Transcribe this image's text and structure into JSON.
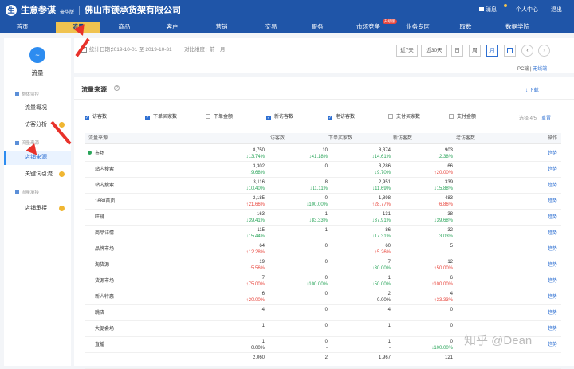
{
  "header": {
    "logo_char": "生",
    "brand": "生意参谋",
    "edition": "豪华版",
    "store": "佛山市镁承货架有限公司",
    "messages": "消息",
    "personal_center": "个人中心",
    "logout": "退出"
  },
  "nav": [
    {
      "label": "首页"
    },
    {
      "label": "流量",
      "active": true
    },
    {
      "label": "商品"
    },
    {
      "label": "客户"
    },
    {
      "label": "营销"
    },
    {
      "label": "交易"
    },
    {
      "label": "服务"
    },
    {
      "label": "市场竞争"
    },
    {
      "label": "业务专区"
    },
    {
      "label": "取数"
    },
    {
      "label": "数据学院"
    }
  ],
  "nav_badge": "升级版",
  "sidebar": {
    "icon_char": "~",
    "title": "流量",
    "groups": [
      {
        "label": "整体监控"
      },
      {
        "label": "流量来源"
      },
      {
        "label": "流量承接"
      }
    ],
    "items": [
      {
        "label": "流量概况"
      },
      {
        "label": "访客分析"
      },
      {
        "label": "店铺来源",
        "active": true
      },
      {
        "label": "关键词引流"
      },
      {
        "label": "店铺承接"
      }
    ]
  },
  "filter": {
    "date_label": "统计日期：",
    "date_range": "2019-10-01 至 2019-10-31",
    "compare_label": "对比维度：",
    "compare_value": "前一月",
    "btn_7": "近7天",
    "btn_30": "近30天",
    "btn_day": "日",
    "btn_week": "周",
    "btn_month": "月",
    "pc_label": "PC端",
    "wireless": "无线端"
  },
  "panel": {
    "title": "流量来源",
    "help": "?",
    "download": "下载",
    "selected": "选择 4/5",
    "reset": "重置",
    "checkboxes": [
      {
        "label": "访客数",
        "checked": true
      },
      {
        "label": "下单买家数",
        "checked": true
      },
      {
        "label": "下单金额",
        "checked": false
      },
      {
        "label": "新访客数",
        "checked": true
      },
      {
        "label": "老访客数",
        "checked": true
      },
      {
        "label": "支付买家数",
        "checked": false
      },
      {
        "label": "支付金额",
        "checked": false
      }
    ]
  },
  "table": {
    "headers": [
      "流量来源",
      "访客数",
      "下单买家数",
      "新访客数",
      "老访客数",
      "操作"
    ],
    "rows": [
      {
        "name": "市场",
        "dot": true,
        "c": [
          [
            "8,750",
            "13.74%",
            "dn"
          ],
          [
            "10",
            "41.18%",
            "dn"
          ],
          [
            "8,374",
            "14.61%",
            "dn"
          ],
          [
            "903",
            "2.38%",
            "dn"
          ]
        ],
        "action": "趋势"
      },
      {
        "name": "站内搜索",
        "c": [
          [
            "3,302",
            "9.68%",
            "dn"
          ],
          [
            "0",
            "",
            ""
          ],
          [
            "3,286",
            "9.70%",
            "dn"
          ],
          [
            "66",
            "20.00%",
            "up"
          ]
        ],
        "action": "趋势"
      },
      {
        "name": "站内搜索",
        "c": [
          [
            "3,116",
            "10.40%",
            "dn"
          ],
          [
            "8",
            "11.11%",
            "dn"
          ],
          [
            "2,951",
            "11.69%",
            "dn"
          ],
          [
            "339",
            "15.88%",
            "dn"
          ]
        ],
        "action": "趋势"
      },
      {
        "name": "1688首页",
        "c": [
          [
            "2,185",
            "21.66%",
            "up"
          ],
          [
            "0",
            "100.00%",
            "dn"
          ],
          [
            "1,898",
            "28.77%",
            "up"
          ],
          [
            "483",
            "6.86%",
            "up"
          ]
        ],
        "action": "趋势"
      },
      {
        "name": "旺铺",
        "c": [
          [
            "163",
            "39.41%",
            "dn"
          ],
          [
            "1",
            "83.33%",
            "dn"
          ],
          [
            "131",
            "37.91%",
            "dn"
          ],
          [
            "38",
            "39.68%",
            "dn"
          ]
        ],
        "action": "趋势"
      },
      {
        "name": "商品详情",
        "c": [
          [
            "115",
            "15.44%",
            "dn"
          ],
          [
            "1",
            "",
            ""
          ],
          [
            "86",
            "17.31%",
            "dn"
          ],
          [
            "32",
            "3.03%",
            "dn"
          ]
        ],
        "action": "趋势"
      },
      {
        "name": "品牌市场",
        "c": [
          [
            "64",
            "12.28%",
            "up"
          ],
          [
            "0",
            "",
            ""
          ],
          [
            "60",
            "5.26%",
            "up"
          ],
          [
            "5",
            "",
            ""
          ]
        ],
        "action": "趋势"
      },
      {
        "name": "淘货源",
        "c": [
          [
            "19",
            "5.56%",
            "up"
          ],
          [
            "0",
            "",
            ""
          ],
          [
            "7",
            "30.00%",
            "dn"
          ],
          [
            "12",
            "50.00%",
            "up"
          ]
        ],
        "action": "趋势"
      },
      {
        "name": "货源市场",
        "c": [
          [
            "7",
            "75.00%",
            "up"
          ],
          [
            "0",
            "100.00%",
            "dn"
          ],
          [
            "1",
            "50.00%",
            "dn"
          ],
          [
            "6",
            "100.00%",
            "up"
          ]
        ],
        "action": "趋势"
      },
      {
        "name": "新人特惠",
        "c": [
          [
            "6",
            "20.00%",
            "up"
          ],
          [
            "0",
            "",
            ""
          ],
          [
            "2",
            "0.00%",
            "nt"
          ],
          [
            "4",
            "33.33%",
            "up"
          ]
        ],
        "action": "趋势"
      },
      {
        "name": "跳店",
        "c": [
          [
            "4",
            "-",
            "nt"
          ],
          [
            "0",
            "-",
            "nt"
          ],
          [
            "4",
            "-",
            "nt"
          ],
          [
            "0",
            "-",
            "nt"
          ]
        ],
        "action": "趋势"
      },
      {
        "name": "大促会场",
        "c": [
          [
            "1",
            "-",
            "nt"
          ],
          [
            "0",
            "-",
            "nt"
          ],
          [
            "1",
            "-",
            "nt"
          ],
          [
            "0",
            "-",
            "nt"
          ]
        ],
        "action": "趋势"
      },
      {
        "name": "直播",
        "c": [
          [
            "1",
            "0.00%",
            "nt"
          ],
          [
            "0",
            "-",
            "nt"
          ],
          [
            "1",
            "-",
            "nt"
          ],
          [
            "0",
            "100.00%",
            "dn"
          ]
        ],
        "action": "趋势"
      },
      {
        "name": "",
        "c": [
          [
            "2,060",
            "",
            ""
          ],
          [
            "2",
            "",
            ""
          ],
          [
            "1,967",
            "",
            ""
          ],
          [
            "121",
            "",
            ""
          ]
        ],
        "action": ""
      }
    ]
  },
  "watermark": "知乎 @Dean",
  "colors": {
    "header_bg": "#1f55a8",
    "active_tab": "#f0c350",
    "link": "#2d6fd2",
    "up": "#e8453c",
    "down": "#2aa55a",
    "annotation_arrow": "#e8312a"
  }
}
